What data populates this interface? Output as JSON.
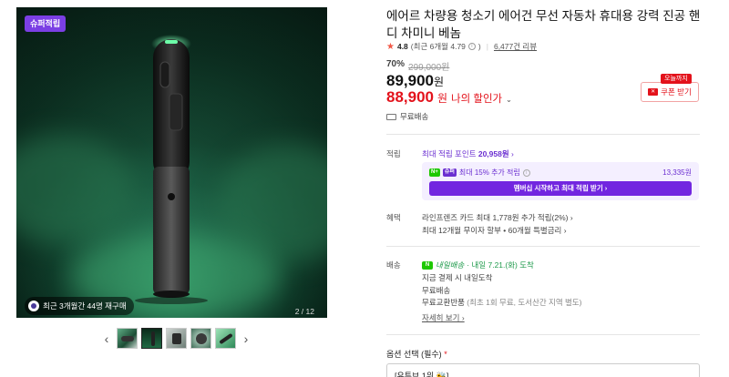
{
  "gallery": {
    "badge": "슈퍼적립",
    "repurchase_text": "최근 3개월간 44명 재구매",
    "counter": "2 / 12",
    "prev_arrow": "‹",
    "next_arrow": "›",
    "thumbnail_count": 5,
    "active_thumbnail": 2
  },
  "product": {
    "title": "에어르 차량용 청소기 에어건 무선 자동차 휴대용 강력 진공 핸디 차미니 베놈",
    "rating": {
      "star": "★",
      "score": "4.8",
      "recent": "(최근 6개월 4.79",
      "recent_close": ")",
      "reviews": "6,477건 리뷰"
    },
    "discount_pct": "70%",
    "original_price": "299,000원",
    "price": "89,900",
    "price_unit": "원",
    "my_price": "88,900",
    "my_price_unit": "원",
    "my_price_label": "나의 할인가",
    "coupon_tag": "오늘까지",
    "coupon_label": "쿠폰 받기",
    "free_shipping": "무료배송"
  },
  "points": {
    "row_label": "적립",
    "max_points_prefix": "최대 적립 포인트",
    "max_points_value": "20,958원",
    "member_text": "최대 15% 추가 적립",
    "member_amount": "13,335원",
    "member_button": "멤버십 시작하고 최대 적립 받기 ›"
  },
  "benefits": {
    "row_label": "혜택",
    "line1": "라인프렌즈 카드 최대 1,778원 추가 적립(2%) ›",
    "line2": "최대 12개월 무이자 할부 • 60개월 특별금리 ›"
  },
  "delivery": {
    "row_label": "배송",
    "badge": "N",
    "head_brand": "내일배송",
    "head_date": "· 내일 7.21.(화) 도착",
    "line1": "지금 결제 시 내일도착",
    "line2": "무료배송",
    "line3_main": "무료교환반품",
    "line3_sub": "(최초 1회 무료, 도서산간 지역 별도)",
    "more": "자세히 보기 ›"
  },
  "options": {
    "label": "옵션 선택 (필수)",
    "required_mark": "*",
    "selected": "[유튜브 1위 🐝]"
  }
}
